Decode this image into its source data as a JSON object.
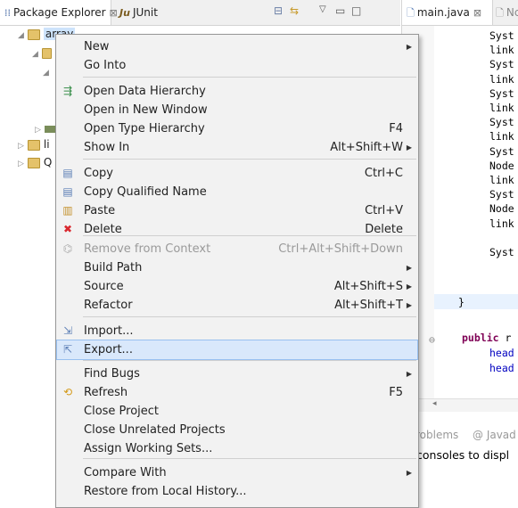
{
  "left_view": {
    "tabs": [
      {
        "label": "Package Explorer",
        "close": "⊠"
      },
      {
        "label": "JUnit",
        "icon_text": "Ju"
      }
    ],
    "tree": [
      {
        "label": "array"
      },
      {
        "label": "li"
      },
      {
        "label": "Q"
      }
    ]
  },
  "editor": {
    "tabs": [
      {
        "label": "main.java",
        "close": "⊠"
      },
      {
        "label": "Nc"
      }
    ],
    "code_lines": [
      "Syst",
      "link",
      "Syst",
      "link",
      "Syst",
      "link",
      "Syst",
      "link",
      "Syst",
      "Node",
      "link",
      "Syst",
      "Node",
      "link",
      "",
      "Syst"
    ],
    "closing_brace": "}",
    "public_keyword": "public",
    "public_rest": "r",
    "head_lines": [
      "head",
      "head"
    ]
  },
  "bottom_panel": {
    "tabs": [
      "roblems",
      "@ Javad"
    ],
    "console_message": "consoles to displ"
  },
  "context_menu": {
    "items": [
      {
        "label": "New",
        "shortcut": "",
        "submenu": true,
        "icon": ""
      },
      {
        "label": "Go Into",
        "shortcut": "",
        "submenu": false,
        "icon": ""
      },
      {
        "label": "Open Data Hierarchy",
        "shortcut": "",
        "submenu": false,
        "icon": "hierarchy-icon"
      },
      {
        "label": "Open in New Window",
        "shortcut": "",
        "submenu": false,
        "icon": ""
      },
      {
        "label": "Open Type Hierarchy",
        "shortcut": "F4",
        "submenu": false,
        "icon": ""
      },
      {
        "label": "Show In",
        "shortcut": "Alt+Shift+W",
        "submenu": true,
        "icon": ""
      },
      {
        "label": "Copy",
        "shortcut": "Ctrl+C",
        "submenu": false,
        "icon": "copy-icon"
      },
      {
        "label": "Copy Qualified Name",
        "shortcut": "",
        "submenu": false,
        "icon": "copy-qualified-icon"
      },
      {
        "label": "Paste",
        "shortcut": "Ctrl+V",
        "submenu": false,
        "icon": "paste-icon"
      },
      {
        "label": "Delete",
        "shortcut": "Delete",
        "submenu": false,
        "icon": "delete-icon"
      },
      {
        "label": "Remove from Context",
        "shortcut": "Ctrl+Alt+Shift+Down",
        "submenu": false,
        "icon": "remove-context-icon",
        "disabled": true
      },
      {
        "label": "Build Path",
        "shortcut": "",
        "submenu": true,
        "icon": ""
      },
      {
        "label": "Source",
        "shortcut": "Alt+Shift+S",
        "submenu": true,
        "icon": ""
      },
      {
        "label": "Refactor",
        "shortcut": "Alt+Shift+T",
        "submenu": true,
        "icon": ""
      },
      {
        "label": "Import...",
        "shortcut": "",
        "submenu": false,
        "icon": "import-icon"
      },
      {
        "label": "Export...",
        "shortcut": "",
        "submenu": false,
        "icon": "export-icon",
        "hover": true
      },
      {
        "label": "Find Bugs",
        "shortcut": "",
        "submenu": true,
        "icon": ""
      },
      {
        "label": "Refresh",
        "shortcut": "F5",
        "submenu": false,
        "icon": "refresh-icon"
      },
      {
        "label": "Close Project",
        "shortcut": "",
        "submenu": false,
        "icon": ""
      },
      {
        "label": "Close Unrelated Projects",
        "shortcut": "",
        "submenu": false,
        "icon": ""
      },
      {
        "label": "Assign Working Sets...",
        "shortcut": "",
        "submenu": false,
        "icon": ""
      },
      {
        "label": "Compare With",
        "shortcut": "",
        "submenu": true,
        "icon": ""
      },
      {
        "label": "Restore from Local History...",
        "shortcut": "",
        "submenu": false,
        "icon": ""
      }
    ]
  },
  "colors": {
    "menu_background": "#f2f2f2",
    "menu_hover": "#d9e8fb",
    "keyword": "#7f0055",
    "field": "#0000c0",
    "delete_icon": "#d9282f"
  }
}
